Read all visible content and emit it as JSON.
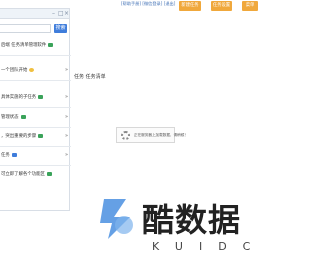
{
  "panel": {
    "search_placeholder": "",
    "search_button": "搜索",
    "items": [
      {
        "label": "后端 任务清单管理软件",
        "tag_color": "#3aa35a"
      },
      {
        "label": "一个团队开始",
        "tag_color": "#f0c040"
      },
      {
        "label": "具体实施的子任务",
        "tag_color": "#3aa35a"
      },
      {
        "label": "管理状态",
        "tag_color": "#3aa35a"
      },
      {
        "label": "，突出重要的步骤",
        "tag_color": "#3aa35a"
      },
      {
        "label": "任务",
        "tag_color": "#3f7ddb"
      },
      {
        "label": "可立即了解各个功能区",
        "tag_color": "#3aa35a"
      }
    ],
    "arrow": "»"
  },
  "side_text": "任务 任务清单",
  "top_links": "[帮助手册] [微信登录] [退出]",
  "top_buttons": [
    "新建任务",
    "任务设置",
    "菜单"
  ],
  "loading_text": "正在服务器上加载数据，请稍候！",
  "watermark": {
    "logo_color": "#4a8fe0",
    "title": "酷数据",
    "subtitle": "KUIDC"
  }
}
